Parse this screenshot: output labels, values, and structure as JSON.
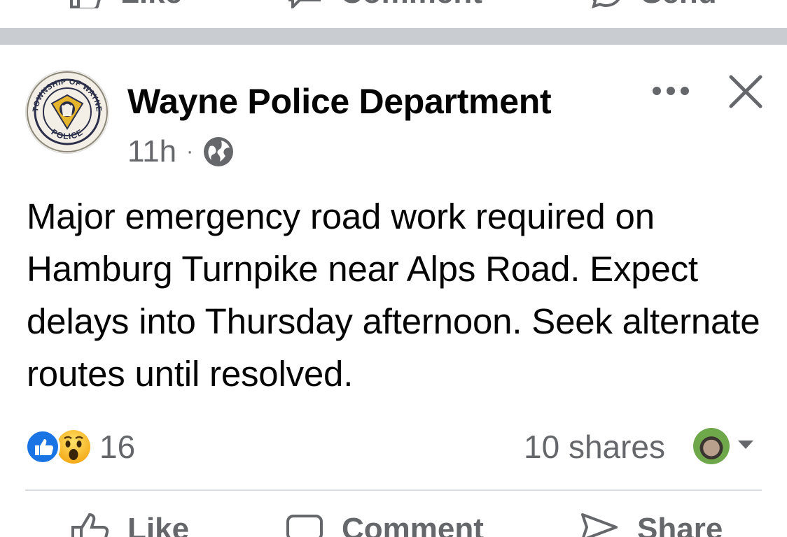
{
  "post": {
    "page_name": "Wayne Police Department",
    "timestamp": "11h",
    "separator": "·",
    "audience_icon": "globe-icon",
    "text": "Major emergency road work required on Hamburg Turnpike near Alps Road. Expect delays into Thursday afternoon. Seek alternate routes until resolved.",
    "avatar": {
      "top_text": "TOWNSHIP OF WAYNE",
      "bottom_text": "POLICE"
    }
  },
  "engagement": {
    "reactions": [
      "like",
      "wow"
    ],
    "reaction_count": "16",
    "shares": "10 shares"
  },
  "actions": {
    "like": "Like",
    "comment": "Comment",
    "share": "Share"
  },
  "prev_actions": {
    "like": "Like",
    "comment": "Comment",
    "send": "Send"
  },
  "colors": {
    "text": "#050505",
    "secondary": "#65676b",
    "like_blue": "#1b74e4",
    "separator": "#c9ccd1"
  }
}
